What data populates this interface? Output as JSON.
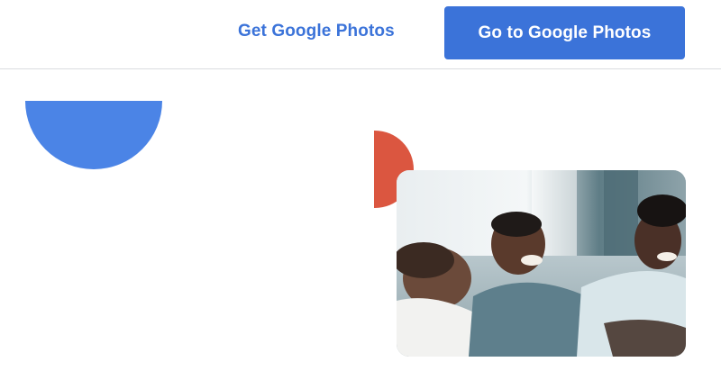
{
  "header": {
    "get_link_label": "Get Google Photos",
    "go_button_label": "Go to Google Photos"
  },
  "colors": {
    "brand_blue": "#3b73d9",
    "shape_blue": "#4b84e6",
    "shape_red": "#db5640",
    "divider": "#dadce0"
  },
  "photo": {
    "alt": "Three friends laughing together on a couch"
  }
}
